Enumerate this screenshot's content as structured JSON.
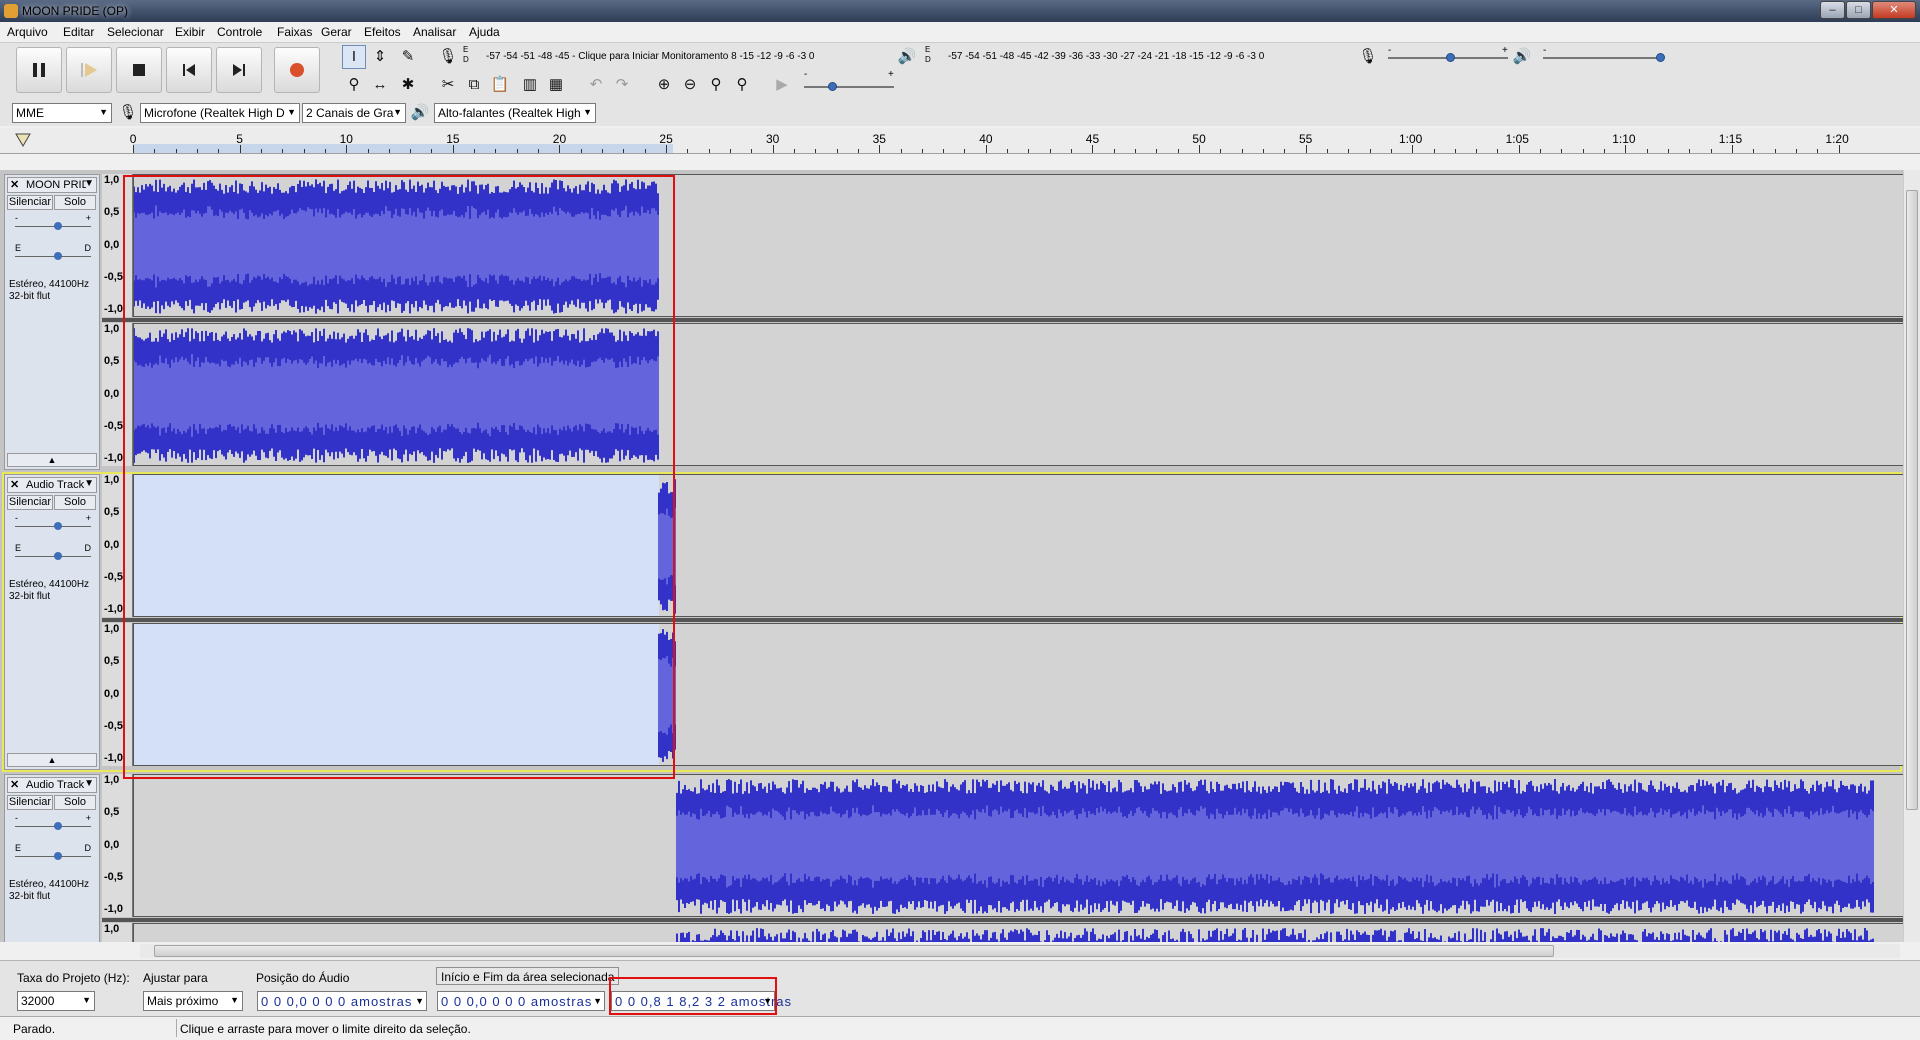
{
  "window": {
    "title": "MOON PRIDE (OP)",
    "controls": [
      "–",
      "□",
      "✕"
    ]
  },
  "menu": [
    "Arquivo",
    "Editar",
    "Selecionar",
    "Exibir",
    "Controle",
    "Faixas",
    "Gerar",
    "Efeitos",
    "Analisar",
    "Ajuda"
  ],
  "meters": {
    "record_ed": "E\nD",
    "record_scale": "-57 -54 -51 -48 -45 - Clique para Iniciar Monitoramento 8 -15 -12  -9  -6  -3  0",
    "play_scale": "-57 -54 -51 -48 -45 -42 -39 -36 -33 -30 -27 -24 -21 -18 -15 -12  -9  -6  -3  0",
    "mixer_minus": "-",
    "mixer_plus": "+"
  },
  "device_toolbar": {
    "host": "MME",
    "input_device": "Microfone (Realtek High D",
    "channels": "2 Canais de Gra",
    "output_device": "Alto-falantes (Realtek High"
  },
  "timeline": {
    "labels": [
      "0",
      "5",
      "10",
      "15",
      "20",
      "25",
      "30",
      "35",
      "40",
      "45",
      "50",
      "55",
      "1:00",
      "1:05",
      "1:10",
      "1:15",
      "1:20"
    ]
  },
  "tracks": [
    {
      "name": "MOON PRIDE",
      "mute": "Silenciar",
      "solo": "Solo",
      "gain_minus": "-",
      "gain_plus": "+",
      "pan_left": "E",
      "pan_right": "D",
      "info_line1": "Estéreo, 44100Hz",
      "info_line2": "32-bit flut",
      "ruler": [
        "1,0",
        "0,5",
        "0,0",
        "-0,5",
        "-1,0"
      ],
      "selected": false
    },
    {
      "name": "Audio Track",
      "mute": "Silenciar",
      "solo": "Solo",
      "gain_minus": "-",
      "gain_plus": "+",
      "pan_left": "E",
      "pan_right": "D",
      "info_line1": "Estéreo, 44100Hz",
      "info_line2": "32-bit flut",
      "ruler": [
        "1,0",
        "0,5",
        "0,0",
        "-0,5",
        "-1,0"
      ],
      "selected": true
    },
    {
      "name": "Audio Track",
      "mute": "Silenciar",
      "solo": "Solo",
      "gain_minus": "-",
      "gain_plus": "+",
      "pan_left": "E",
      "pan_right": "D",
      "info_line1": "Estéreo, 44100Hz",
      "info_line2": "32-bit flut",
      "ruler": [
        "1,0",
        "0,5",
        "0,0",
        "-0,5",
        "-1,0"
      ],
      "selected": false
    }
  ],
  "selection_bar": {
    "rate_label": "Taxa do Projeto (Hz):",
    "rate_value": "32000",
    "snap_label": "Ajustar para",
    "snap_value": "Mais próximo",
    "position_label": "Posição do Áudio",
    "position_value": "0 0 0,0 0 0 0 amostras",
    "selection_label": "Início e Fim da área selecionada",
    "selection_start": "0 0 0,0 0 0 0 amostras",
    "selection_end": "0 0 0,8 1 8,2 3 2 amostras"
  },
  "status": {
    "state": "Parado.",
    "hint": "Clique e arraste para mover o limite direito da seleção."
  },
  "colors": {
    "waveform": "#3232c8",
    "waveform_rms": "#6464dc",
    "selection": "#d4e0f7",
    "highlight": "#e01010"
  }
}
